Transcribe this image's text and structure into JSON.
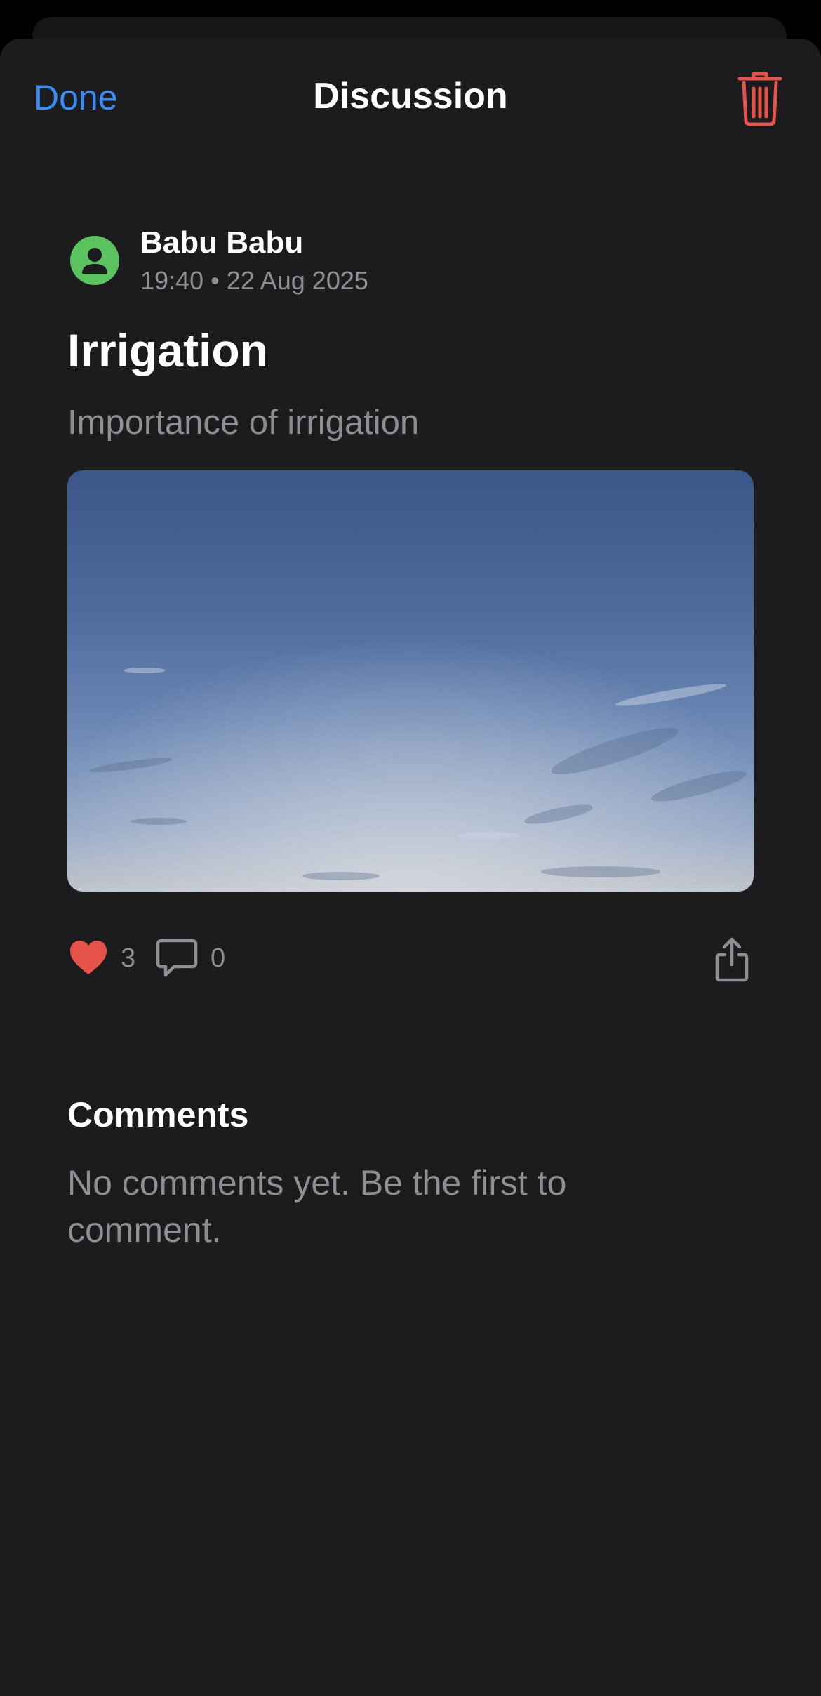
{
  "nav": {
    "done_label": "Done",
    "title": "Discussion",
    "delete_icon": "trash-icon",
    "accent_color": "#3b8cf2",
    "destructive_color": "#e5534b"
  },
  "post": {
    "author_name": "Babu Babu",
    "meta": "19:40 • 22 Aug 2025",
    "title": "Irrigation",
    "subtitle": "Importance of irrigation",
    "image": "sky-photo",
    "avatar_color": "#5ac25f"
  },
  "actions": {
    "like_icon": "heart-icon",
    "like_count": "3",
    "comment_icon": "speech-bubble-icon",
    "comment_count": "0",
    "share_icon": "share-icon"
  },
  "comments": {
    "heading": "Comments",
    "empty_text": "No comments yet. Be the first to comment."
  }
}
